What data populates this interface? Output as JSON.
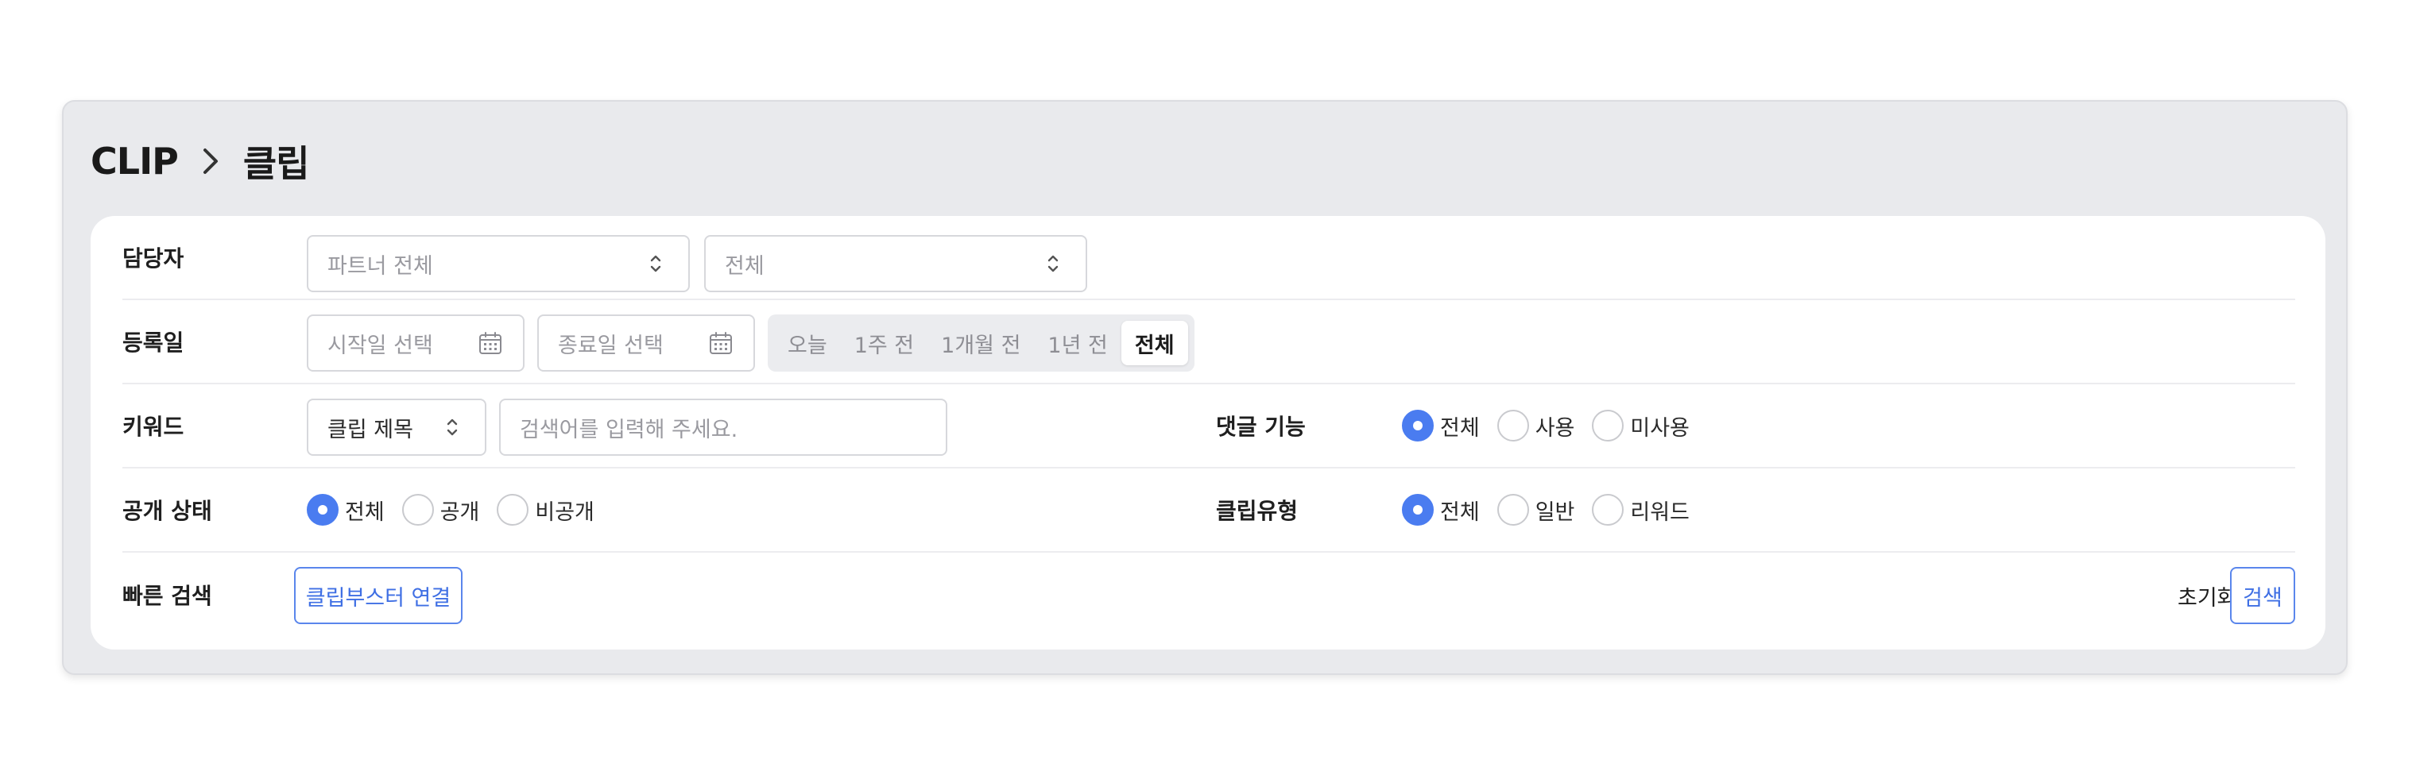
{
  "breadcrumb": {
    "root": "CLIP",
    "current": "클립"
  },
  "manager": {
    "label": "담당자",
    "partner_select": "파트너 전체",
    "sub_select": "전체"
  },
  "registered": {
    "label": "등록일",
    "start_placeholder": "시작일 선택",
    "end_placeholder": "종료일 선택",
    "ranges": [
      "오늘",
      "1주 전",
      "1개월 전",
      "1년 전",
      "전체"
    ],
    "selected_range": "전체"
  },
  "keyword": {
    "label": "키워드",
    "field_select": "클립 제목",
    "search_placeholder": "검색어를 입력해 주세요."
  },
  "comment": {
    "label": "댓글 기능",
    "options": [
      "전체",
      "사용",
      "미사용"
    ],
    "selected": "전체"
  },
  "visibility": {
    "label": "공개 상태",
    "options": [
      "전체",
      "공개",
      "비공개"
    ],
    "selected": "전체"
  },
  "clip_type": {
    "label": "클립유형",
    "options": [
      "전체",
      "일반",
      "리워드"
    ],
    "selected": "전체"
  },
  "quick": {
    "label": "빠른 검색",
    "booster_button": "클립부스터 연결"
  },
  "actions": {
    "reset": "초기화",
    "search": "검색"
  },
  "colors": {
    "accent": "#4a7cf0",
    "panel_bg": "#e9eaed",
    "card_bg": "#ffffff"
  },
  "icons": {
    "breadcrumb_separator": "chevron-right-icon",
    "select": "chevron-up-down-icon",
    "date": "calendar-icon"
  }
}
